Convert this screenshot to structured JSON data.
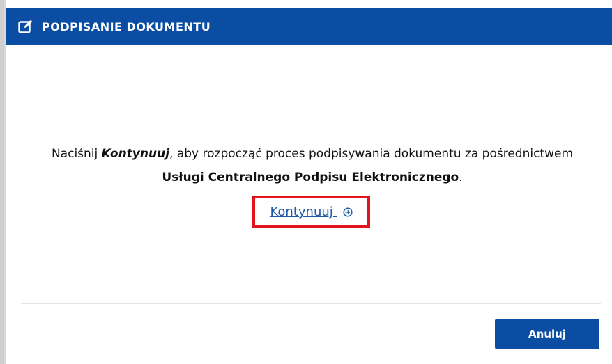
{
  "dialog": {
    "title": "PODPISANIE DOKUMENTU",
    "title_icon": "edit-icon",
    "message": {
      "part1": "Naciśnij ",
      "emphasis": "Kontynuuj",
      "part2": ", aby rozpocząć proces podpisywania dokumentu za pośrednictwem ",
      "service": "Usługi Centralnego Podpisu Elektronicznego",
      "part3": "."
    },
    "continue_link": {
      "label": "Kontynuuj ",
      "icon": "arrow-right-circle-icon"
    },
    "cancel_button": "Anuluj"
  },
  "colors": {
    "header_bg": "#0a4da3",
    "header_text": "#ffffff",
    "link": "#1f5aa8",
    "highlight_border": "#e2141b",
    "button_bg": "#0a4da3"
  }
}
